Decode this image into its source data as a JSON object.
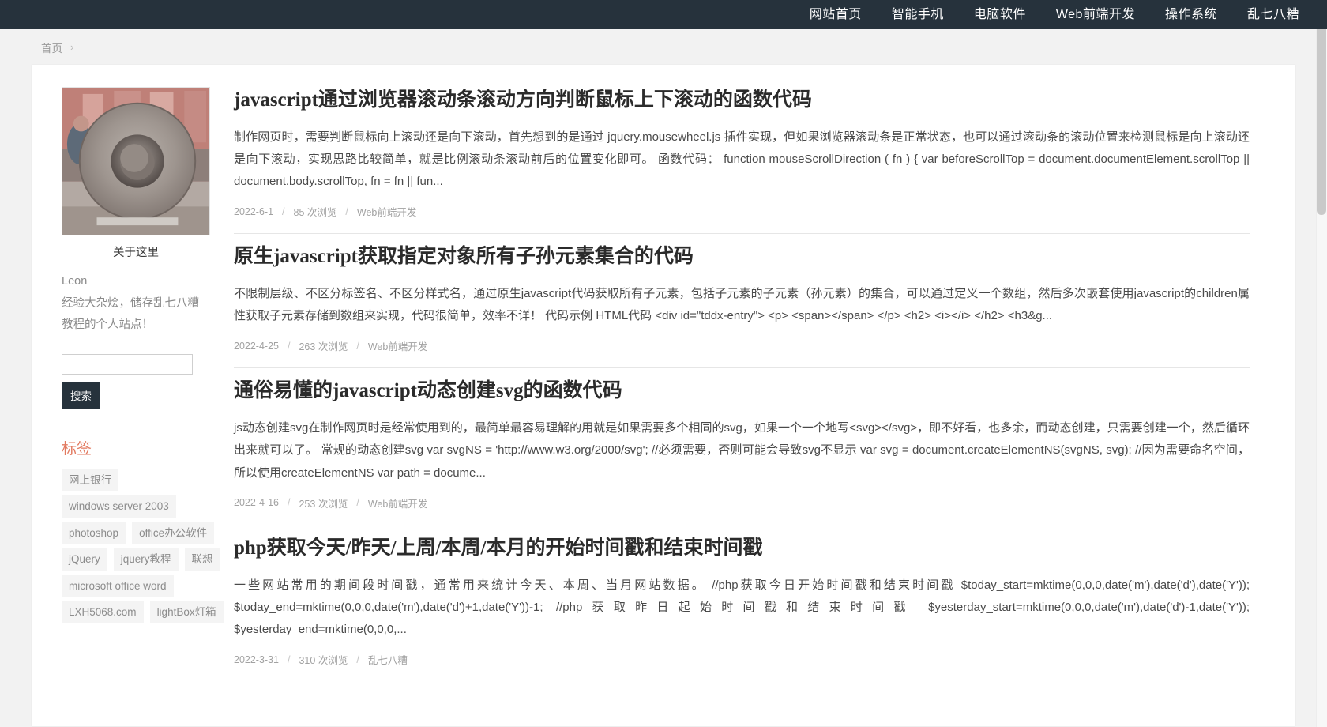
{
  "nav": {
    "items": [
      {
        "label": "网站首页"
      },
      {
        "label": "智能手机"
      },
      {
        "label": "电脑软件"
      },
      {
        "label": "Web前端开发"
      },
      {
        "label": "操作系统"
      },
      {
        "label": "乱七八糟"
      }
    ]
  },
  "breadcrumb": {
    "home": "首页",
    "separator": "›"
  },
  "sidebar": {
    "about": {
      "image_alt": "石碾磨盘照片",
      "caption": "关于这里",
      "name": "Leon",
      "description": "经验大杂烩，储存乱七八糟教程的个人站点！"
    },
    "search": {
      "value": "",
      "placeholder": "",
      "button_label": "搜索"
    },
    "tags": {
      "title": "标签",
      "items": [
        {
          "label": "网上银行"
        },
        {
          "label": "windows server 2003"
        },
        {
          "label": "photoshop"
        },
        {
          "label": "office办公软件"
        },
        {
          "label": "jQuery"
        },
        {
          "label": "jquery教程"
        },
        {
          "label": "联想"
        },
        {
          "label": "microsoft office word"
        },
        {
          "label": "LXH5068.com"
        },
        {
          "label": "lightBox灯箱"
        }
      ]
    }
  },
  "posts": [
    {
      "title": "javascript通过浏览器滚动条滚动方向判断鼠标上下滚动的函数代码",
      "excerpt": "制作网页时，需要判断鼠标向上滚动还是向下滚动，首先想到的是通过 jquery.mousewheel.js 插件实现，但如果浏览器滚动条是正常状态，也可以通过滚动条的滚动位置来检测鼠标是向上滚动还是向下滚动，实现思路比较简单，就是比例滚动条滚动前后的位置变化即可。 函数代码： function mouseScrollDirection ( fn ) { var beforeScrollTop = document.documentElement.scrollTop || document.body.scrollTop, fn = fn || fun...",
      "date": "2022-6-1",
      "views": "85 次浏览",
      "category": "Web前端开发"
    },
    {
      "title": "原生javascript获取指定对象所有子孙元素集合的代码",
      "excerpt": "不限制层级、不区分标签名、不区分样式名，通过原生javascript代码获取所有子元素，包括子元素的子元素（孙元素）的集合，可以通过定义一个数组，然后多次嵌套使用javascript的children属性获取子元素存储到数组来实现，代码很简单，效率不详！ 代码示例 HTML代码 <div id=\"tddx-entry\"> <p> <span></span> </p> <h2> <i></i> </h2> <h3&g...",
      "date": "2022-4-25",
      "views": "263 次浏览",
      "category": "Web前端开发"
    },
    {
      "title": "通俗易懂的javascript动态创建svg的函数代码",
      "excerpt": "js动态创建svg在制作网页时是经常使用到的，最简单最容易理解的用就是如果需要多个相同的svg，如果一个一个地写<svg></svg>，即不好看，也多余，而动态创建，只需要创建一个，然后循环出来就可以了。 常规的动态创建svg var svgNS = 'http://www.w3.org/2000/svg'; //必须需要，否则可能会导致svg不显示 var svg = document.createElementNS(svgNS, svg); //因为需要命名空间，所以使用createElementNS var path = docume...",
      "date": "2022-4-16",
      "views": "253 次浏览",
      "category": "Web前端开发"
    },
    {
      "title": "php获取今天/昨天/上周/本周/本月的开始时间戳和结束时间戳",
      "excerpt": "一些网站常用的期间段时间戳，通常用来统计今天、本周、当月网站数据。 //php获取今日开始时间戳和结束时间戳 $today_start=mktime(0,0,0,date('m'),date('d'),date('Y')); $today_end=mktime(0,0,0,date('m'),date('d')+1,date('Y'))-1; //php获取昨日起始时间戳和结束时间戳 $yesterday_start=mktime(0,0,0,date('m'),date('d')-1,date('Y')); $yesterday_end=mktime(0,0,0,...",
      "date": "2022-3-31",
      "views": "310 次浏览",
      "category": "乱七八糟"
    }
  ],
  "meta_separator": "/",
  "colors": {
    "nav_bg": "#26323c",
    "accent": "#e2795f",
    "page_bg": "#f2f2f2",
    "card_bg": "#ffffff"
  }
}
